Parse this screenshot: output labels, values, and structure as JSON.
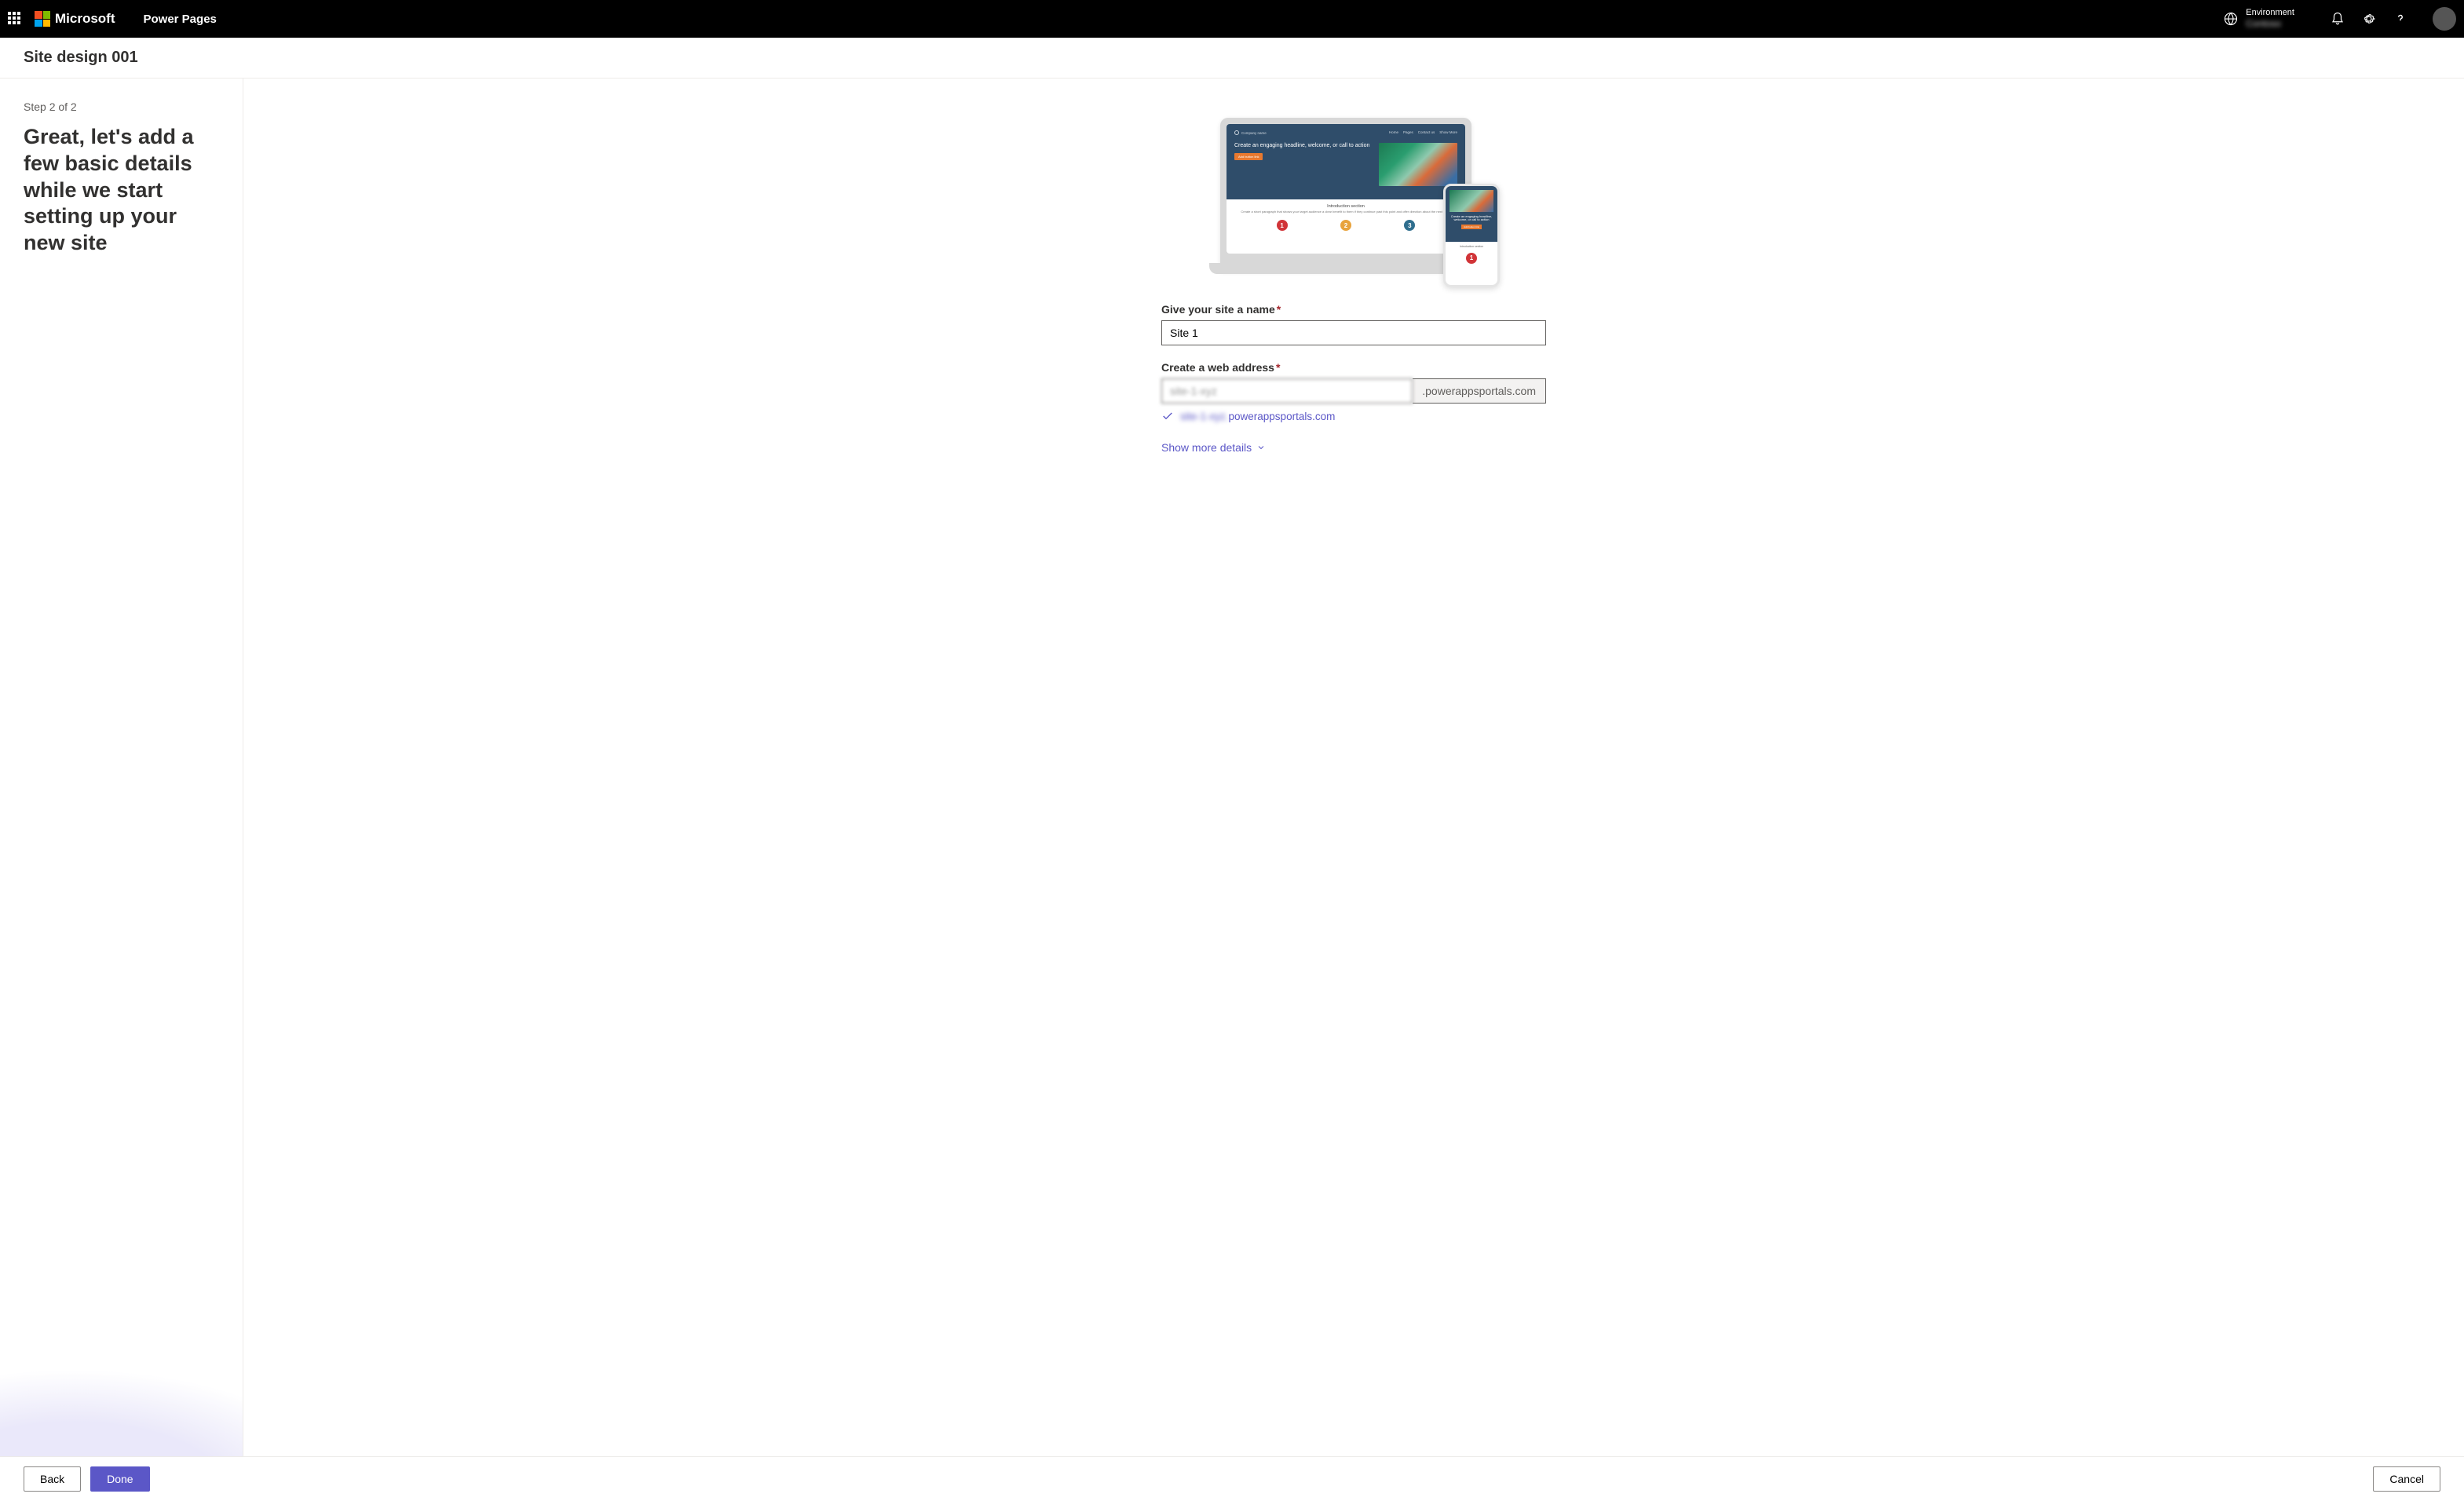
{
  "header": {
    "brand": "Microsoft",
    "product": "Power Pages",
    "environment_label": "Environment",
    "environment_name": "Contoso"
  },
  "subheader": {
    "title": "Site design 001"
  },
  "left": {
    "step_label": "Step 2 of 2",
    "title": "Great, let's add a few basic details while we start setting up your new site"
  },
  "preview": {
    "company": "Company name",
    "nav": {
      "home": "Home",
      "pages": "Pages",
      "contact": "Contact us",
      "more": "Show More"
    },
    "headline": "Create an engaging headline, welcome, or call to action",
    "cta": "Add button link",
    "intro_title": "Introduction section",
    "intro_body": "Create a short paragraph that shows your target audience a clear benefit to them if they continue past this point and offer direction about the next steps",
    "circles": {
      "one": "1",
      "two": "2",
      "three": "3"
    }
  },
  "form": {
    "name_label": "Give your site a name",
    "name_value": "Site 1",
    "addr_label": "Create a web address",
    "addr_value": "site-1-xyz",
    "addr_suffix": ".powerappsportals.com",
    "validated_prefix": "site-1-xyz.",
    "validated_domain": "powerappsportals.com",
    "show_more": "Show more details"
  },
  "footer": {
    "back": "Back",
    "done": "Done",
    "cancel": "Cancel"
  }
}
